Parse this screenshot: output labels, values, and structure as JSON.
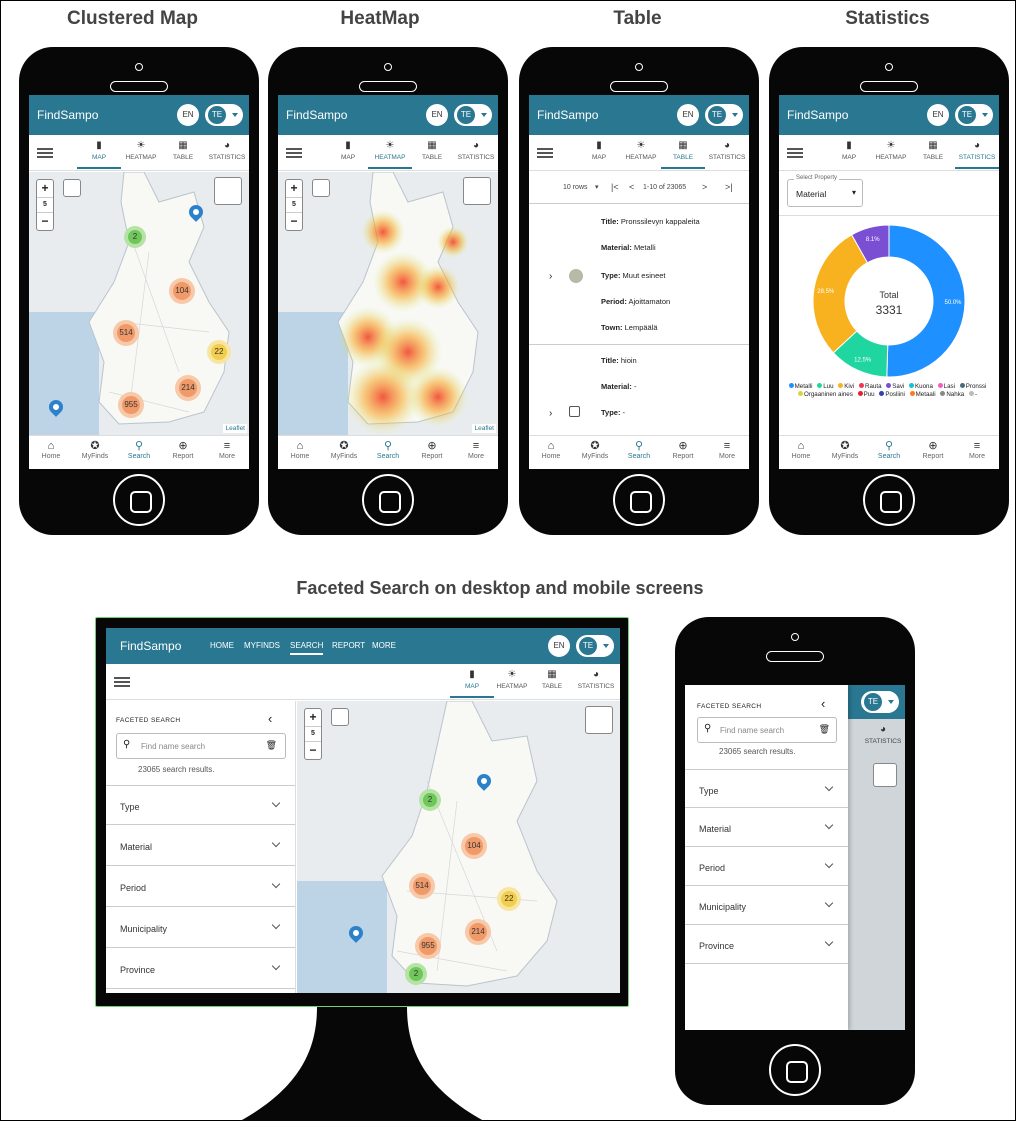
{
  "headings": {
    "clustered": "Clustered Map",
    "heatmap": "HeatMap",
    "table": "Table",
    "statistics": "Statistics",
    "faceted": "Faceted Search on desktop and mobile screens"
  },
  "app": {
    "brand": "FindSampo",
    "lang": "EN",
    "user": "TE",
    "accent": "#297791"
  },
  "tabs": [
    {
      "label": "MAP",
      "icon": "map-icon",
      "glyph": "▮"
    },
    {
      "label": "HEATMAP",
      "icon": "heatmap-icon",
      "glyph": "☀"
    },
    {
      "label": "TABLE",
      "icon": "table-icon",
      "glyph": "▦"
    },
    {
      "label": "STATISTICS",
      "icon": "pie-icon",
      "glyph": "◕"
    }
  ],
  "bottom_nav": [
    {
      "label": "Home",
      "icon": "home-icon",
      "glyph": "⌂"
    },
    {
      "label": "MyFinds",
      "icon": "star-icon",
      "glyph": "✪"
    },
    {
      "label": "Search",
      "icon": "search-icon",
      "glyph": "⚲"
    },
    {
      "label": "Report",
      "icon": "add-icon",
      "glyph": "⊕"
    },
    {
      "label": "More",
      "icon": "menu-icon",
      "glyph": "≡"
    }
  ],
  "map": {
    "zoom_in": "+",
    "zoom_level": "5",
    "zoom_out": "−",
    "attribution": "Leaflet",
    "clusters": [
      "2",
      "104",
      "514",
      "22",
      "214",
      "955"
    ]
  },
  "table": {
    "rows_per_page": "10 rows",
    "range": "1-10 of 23065",
    "rows": [
      {
        "title": "Pronssilevyn kappaleita",
        "material": "Metalli",
        "type": "Muut esineet",
        "period": "Ajoittamaton",
        "town": "Lempäälä"
      },
      {
        "title": "hioin",
        "material": "-",
        "type": "-"
      }
    ],
    "labels": {
      "title": "Title:",
      "material": "Material:",
      "type": "Type:",
      "period": "Period:",
      "town": "Town:"
    }
  },
  "statistics": {
    "select_label": "Select Property",
    "select_value": "Material",
    "total_label": "Total",
    "total_value": "3331"
  },
  "chart_data": {
    "type": "pie",
    "title": "",
    "center_label": "Total",
    "center_value": "3331",
    "slices": [
      {
        "name": "Metalli",
        "value": 50.0,
        "label": "50.0%",
        "color": "#1e90ff"
      },
      {
        "name": "Luu",
        "value": 12.5,
        "label": "12.5%",
        "color": "#20d6a0"
      },
      {
        "name": "Kivi",
        "value": 28.5,
        "label": "28.5%",
        "color": "#f8b21f"
      },
      {
        "name": "Savi",
        "value": 8.1,
        "label": "8.1%",
        "color": "#7b4fd4"
      }
    ],
    "legend": [
      {
        "name": "Metalli",
        "color": "#1e90ff"
      },
      {
        "name": "Luu",
        "color": "#20d6a0"
      },
      {
        "name": "Kivi",
        "color": "#f8b21f"
      },
      {
        "name": "Rauta",
        "color": "#f2344f"
      },
      {
        "name": "Savi",
        "color": "#7b4fd4"
      },
      {
        "name": "Kuona",
        "color": "#18c3c9"
      },
      {
        "name": "Lasi",
        "color": "#f25cc6"
      },
      {
        "name": "Pronssi",
        "color": "#4a6b7c"
      },
      {
        "name": "Orgaaninen aines",
        "color": "#d8d63a"
      },
      {
        "name": "Puu",
        "color": "#e8202c"
      },
      {
        "name": "Posliini",
        "color": "#3040b0"
      },
      {
        "name": "Metaali",
        "color": "#ff7b1a"
      },
      {
        "name": "Nahka",
        "color": "#888888"
      },
      {
        "name": "-",
        "color": "#bbbbbb"
      }
    ]
  },
  "desktop_nav": [
    "HOME",
    "MYFINDS",
    "SEARCH",
    "REPORT",
    "MORE"
  ],
  "facets": {
    "title": "FACETED SEARCH",
    "search_placeholder": "Find name search",
    "results": "23065 search results.",
    "items": [
      "Type",
      "Material",
      "Period",
      "Municipality",
      "Province"
    ]
  }
}
